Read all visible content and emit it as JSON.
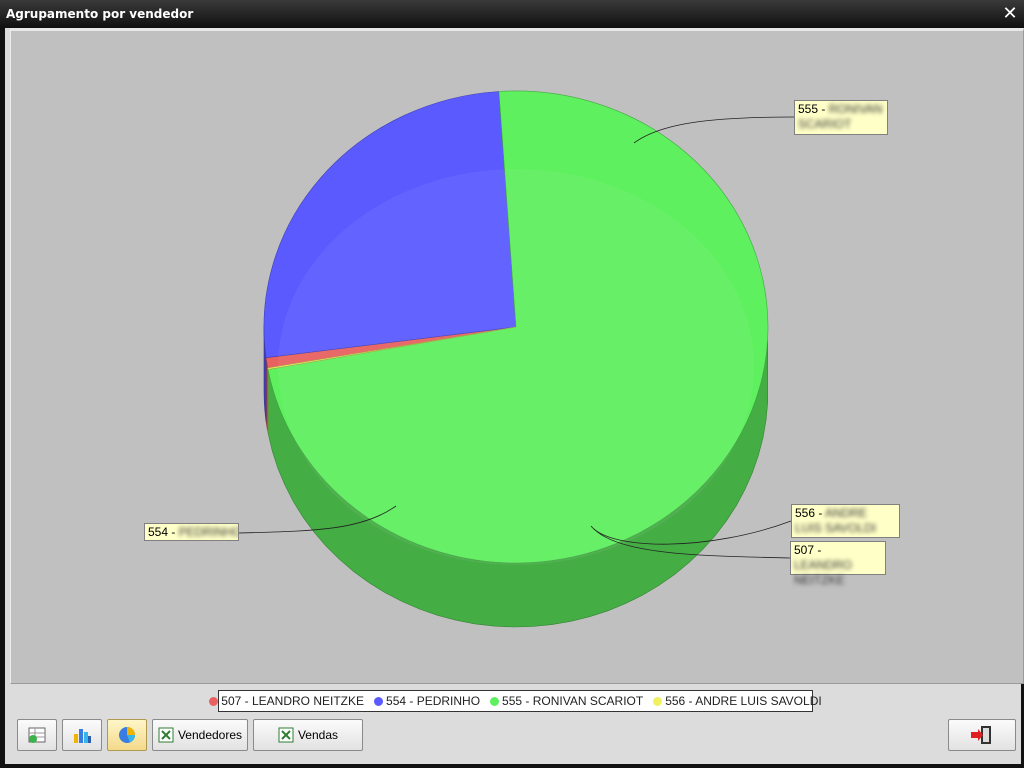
{
  "window": {
    "title": "Agrupamento por vendedor",
    "close_glyph": "✕"
  },
  "chart_data": {
    "type": "pie",
    "title": "",
    "categories": [
      "507 - LEANDRO NEITZKE",
      "554 - PEDRINHO",
      "555 - RONIVAN SCARIOT",
      "556 - ANDRE LUIS SAVOLDI"
    ],
    "values": [
      0.7,
      26.0,
      73.2,
      0.1
    ],
    "colors": [
      "#e86060",
      "#5a5aff",
      "#5ef05e",
      "#f0f060"
    ],
    "legend_position": "bottom",
    "callouts": [
      {
        "prefix": "555 - ",
        "blurred_text": "RONIVAN SCARIOT"
      },
      {
        "prefix": "554 - ",
        "blurred_text": "PEDRINHO"
      },
      {
        "prefix": "556 - ",
        "blurred_text": "ANDRE LUIS SAVOLDI"
      },
      {
        "prefix": "507 - ",
        "blurred_text": "LEANDRO NEITZKE"
      }
    ]
  },
  "legend": {
    "items": [
      {
        "label": "507 - LEANDRO NEITZKE",
        "color": "#e86060"
      },
      {
        "label": "554 - PEDRINHO",
        "color": "#5a5aff"
      },
      {
        "label": "555 - RONIVAN SCARIOT",
        "color": "#5ef05e"
      },
      {
        "label": "556 - ANDRE LUIS SAVOLDI",
        "color": "#f0f060"
      }
    ]
  },
  "toolbar": {
    "buttons": [
      {
        "icon": "refresh-grid-icon",
        "label": ""
      },
      {
        "icon": "bar-chart-icon",
        "label": ""
      },
      {
        "icon": "pie-chart-icon",
        "label": "",
        "active": true
      },
      {
        "icon": "excel-icon",
        "label": "Vendedores"
      },
      {
        "icon": "excel-icon",
        "label": "Vendas"
      }
    ],
    "exit_icon": "exit-door-icon"
  }
}
